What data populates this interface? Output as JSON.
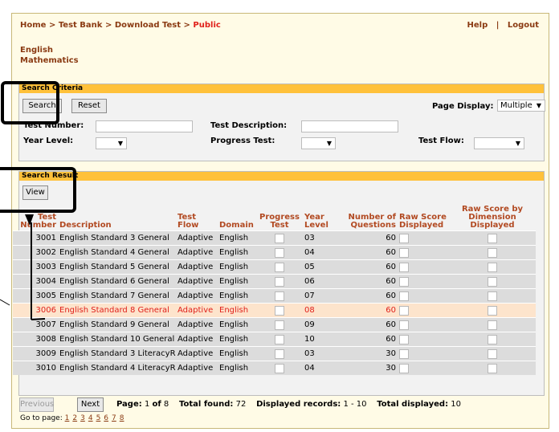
{
  "breadcrumb": {
    "home": "Home",
    "test_bank": "Test Bank",
    "download_test": "Download Test",
    "public": "Public",
    "sep": ">"
  },
  "toplinks": {
    "help": "Help",
    "sep": "|",
    "logout": "Logout"
  },
  "subjects": [
    "English",
    "Mathematics"
  ],
  "search_criteria": {
    "title": "Search Criteria",
    "search_button": "Search",
    "reset_button": "Reset",
    "page_display_label": "Page Display:",
    "page_display_value": "Multiple",
    "test_number_label": "Test Number:",
    "test_number_value": "",
    "test_description_label": "Test Description:",
    "test_description_value": "",
    "year_level_label": "Year Level:",
    "year_level_value": "",
    "progress_test_label": "Progress Test:",
    "progress_test_value": "",
    "test_flow_label": "Test Flow:",
    "test_flow_value": ""
  },
  "search_result": {
    "title": "Search Result",
    "view_button": "View",
    "columns": [
      "Test Number",
      "Description",
      "Test Flow",
      "Domain",
      "Progress Test",
      "Year Level",
      "Number of Questions",
      "Raw Score Displayed",
      "Raw Score by Dimension Displayed"
    ],
    "rows": [
      {
        "num": "3001",
        "desc": "English Standard 3 General",
        "flow": "Adaptive",
        "domain": "English",
        "year": "03",
        "questions": "60",
        "selected": false
      },
      {
        "num": "3002",
        "desc": "English Standard 4 General",
        "flow": "Adaptive",
        "domain": "English",
        "year": "04",
        "questions": "60",
        "selected": false
      },
      {
        "num": "3003",
        "desc": "English Standard 5 General",
        "flow": "Adaptive",
        "domain": "English",
        "year": "05",
        "questions": "60",
        "selected": false
      },
      {
        "num": "3004",
        "desc": "English Standard 6 General",
        "flow": "Adaptive",
        "domain": "English",
        "year": "06",
        "questions": "60",
        "selected": false
      },
      {
        "num": "3005",
        "desc": "English Standard 7 General",
        "flow": "Adaptive",
        "domain": "English",
        "year": "07",
        "questions": "60",
        "selected": false
      },
      {
        "num": "3006",
        "desc": "English Standard 8 General",
        "flow": "Adaptive",
        "domain": "English",
        "year": "08",
        "questions": "60",
        "selected": true
      },
      {
        "num": "3007",
        "desc": "English Standard 9 General",
        "flow": "Adaptive",
        "domain": "English",
        "year": "09",
        "questions": "60",
        "selected": false
      },
      {
        "num": "3008",
        "desc": "English Standard 10 General",
        "flow": "Adaptive",
        "domain": "English",
        "year": "10",
        "questions": "60",
        "selected": false
      },
      {
        "num": "3009",
        "desc": "English Standard 3 LiteracyR",
        "flow": "Adaptive",
        "domain": "English",
        "year": "03",
        "questions": "30",
        "selected": false
      },
      {
        "num": "3010",
        "desc": "English Standard 4 LiteracyR",
        "flow": "Adaptive",
        "domain": "English",
        "year": "04",
        "questions": "30",
        "selected": false
      }
    ]
  },
  "pager": {
    "previous": "Previous",
    "next": "Next",
    "page_label": "Page:",
    "page_current": "1",
    "of_label": "of",
    "page_total": "8",
    "total_found_label": "Total found:",
    "total_found": "72",
    "displayed_records_label": "Displayed records:",
    "displayed_records": "1 - 10",
    "total_displayed_label": "Total displayed:",
    "total_displayed": "10",
    "goto_label": "Go to page:",
    "pages": [
      "1",
      "2",
      "3",
      "4",
      "5",
      "6",
      "7",
      "8"
    ]
  }
}
